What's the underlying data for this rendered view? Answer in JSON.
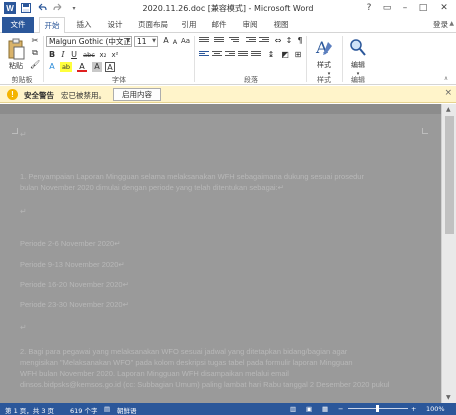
{
  "title": "2020.11.26.doc [兼容模式] - Microsoft Word",
  "window_controls": [
    "?",
    "▭",
    "–",
    "□",
    "✕"
  ],
  "tabs": [
    "文件",
    "开始",
    "插入",
    "设计",
    "页面布局",
    "引用",
    "邮件",
    "审阅",
    "视图"
  ],
  "signin": "登录",
  "ribbon": {
    "font_name": "Malgun Gothic (中文正",
    "font_size": "11",
    "groups": [
      "剪贴板",
      "字体",
      "段落",
      "样式",
      "编辑"
    ],
    "paste_label": "粘贴",
    "styles_label": "样式",
    "editing_label": "编辑",
    "font_letters": {
      "grow": "A",
      "shrink": "A",
      "case": "Aa",
      "clear": "A",
      "bold": "B",
      "italic": "I",
      "underline": "U",
      "strike": "abc",
      "sub": "x₂",
      "sup": "x²",
      "effects": "A",
      "highlight": "ab",
      "color": "A",
      "char_shade": "A",
      "char_border": "A"
    }
  },
  "security": {
    "title": "安全警告",
    "message": "宏已被禁用。",
    "button": "启用内容",
    "close": "×"
  },
  "document": {
    "lines": [
      {
        "type": "mark",
        "text": "↵"
      },
      {
        "type": "text",
        "text": "1. Penyampaian Laporan Mingguan selama melaksanakan WFH sebagaimana dukung sesuai prosedur"
      },
      {
        "type": "text",
        "text": "bulan November 2020 dimulai dengan periode yang telah ditentukan sebagai:↵"
      },
      {
        "type": "mark",
        "text": "↵"
      },
      {
        "type": "text",
        "text": "Periode 2-6 November 2020↵"
      },
      {
        "type": "text",
        "text": "Periode 9-13 November 2020↵"
      },
      {
        "type": "text",
        "text": "Periode 16-20 November 2020↵"
      },
      {
        "type": "text",
        "text": "Periode 23-30 November 2020↵"
      },
      {
        "type": "mark",
        "text": "↵"
      },
      {
        "type": "text",
        "text": "2. Bagi para pegawai yang melaksanakan WFO sesuai jadwal yang ditetapkan bidang/bagian agar"
      },
      {
        "type": "text",
        "text": "mengisikan \"Melaksanakan WFO\" pada kolom deskripsi tugas tabel pada formulir laporan Mingguan"
      },
      {
        "type": "text",
        "text": "WFH bulan November 2020. Laporan Mingguan WFH disampaikan melalui email"
      },
      {
        "type": "text",
        "text": "dinsos.bidpsks@kemsos.go.id (cc: Subbagian Umum) paling lambat hari Rabu tanggal 2 Desember 2020 pukul"
      }
    ]
  },
  "status": {
    "page": "第 1 页，共 3 页",
    "words": "619 个字",
    "lang": "朝鲜语",
    "zoom": "100%"
  }
}
